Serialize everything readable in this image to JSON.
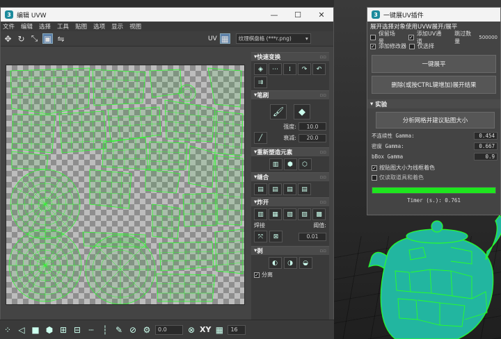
{
  "uvw_window": {
    "title": "编辑 UVW",
    "menu": [
      "文件",
      "编辑",
      "选择",
      "工具",
      "贴图",
      "选项",
      "显示",
      "视图"
    ],
    "uv_label": "UV",
    "texture_dropdown": "纹理棋盘格 (***r.png)",
    "window_buttons": [
      "—",
      "☐",
      "✕"
    ]
  },
  "rollouts": {
    "quick_transform": {
      "title": "快速变换"
    },
    "brush": {
      "title": "笔刷",
      "strength_label": "强度:",
      "strength_value": "10.0",
      "falloff_label": "衰减:",
      "falloff_value": "20.0"
    },
    "reshape": {
      "title": "重新塑造元素"
    },
    "stitch": {
      "title": "缝合"
    },
    "explode": {
      "title": "炸开",
      "weld_label": "焊接",
      "threshold_label": "阈值:",
      "threshold_value": "0.01"
    },
    "peel": {
      "title": "剥",
      "detach_label": "分离"
    }
  },
  "bottom_bar": {
    "rotation_value": "0.0",
    "xy_label": "XY",
    "grid_value": "16"
  },
  "plugin": {
    "title": "一键展UV插件",
    "subtitle": "展开选择对象使用UVW展开/展平",
    "checks": [
      {
        "label": "保留场景",
        "checked": false
      },
      {
        "label": "添加UV通道",
        "checked": true
      },
      {
        "label": "跳过数量",
        "checked": false,
        "value": "500000"
      },
      {
        "label": "添加修改器",
        "checked": true
      },
      {
        "label": "仅选择",
        "checked": false
      }
    ],
    "flatten_button": "一键展平",
    "delete_button": "删除(或按CTRL键增加)展开结果",
    "experiment_title": "实验",
    "analyze_button": "分析网格并建议贴图大小",
    "params": [
      {
        "label": "不连续性 Gamma:",
        "value": "0.454"
      },
      {
        "label": "密度 Gamma:",
        "value": "0.667"
      },
      {
        "label": "bBox Gamma",
        "value": "0.9"
      }
    ],
    "opt_wire": {
      "label": "按贴图大小为线框着色",
      "checked": true
    },
    "opt_read": {
      "label": "仅读取道具和着色",
      "checked": false
    },
    "progress": 1.0,
    "timer": "Timer (s.): 0.761"
  },
  "colors": {
    "accent_green": "#1ee61e",
    "teapot": "#23b9a0",
    "wire": "#28ff28"
  }
}
